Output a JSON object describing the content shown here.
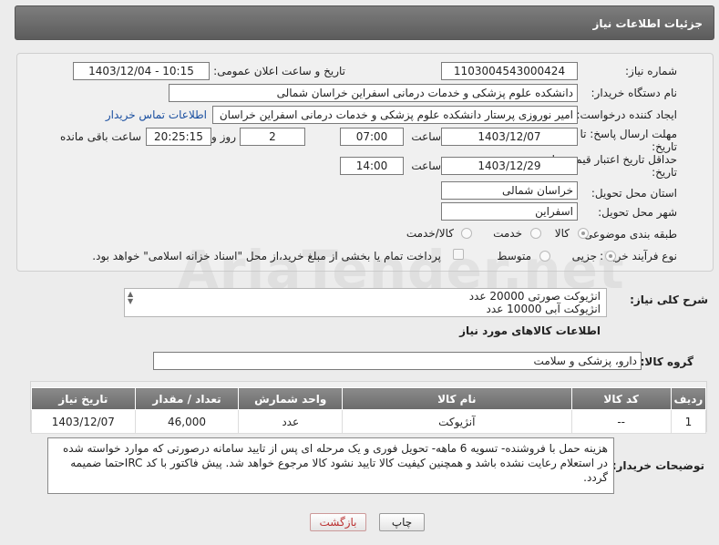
{
  "header": {
    "title": "جزئیات اطلاعات نیاز"
  },
  "watermark": "AriaTender.net",
  "form": {
    "need_number_label": "شماره نیاز:",
    "need_number": "1103004543000424",
    "announce_label": "تاریخ و ساعت اعلان عمومی:",
    "announce_value": "1403/12/04 - 10:15",
    "buyer_org_label": "نام دستگاه خریدار:",
    "buyer_org": "دانشکده علوم پزشکی و خدمات درمانی اسفراین خراسان شمالی",
    "creator_label": "ایجاد کننده درخواست:",
    "creator": "امیر  نوروزی  پرستار  دانشکده علوم پزشکی و خدمات درمانی اسفراین خراسان",
    "contact_link": "اطلاعات تماس خریدار",
    "deadline_label_1": "مهلت ارسال پاسخ: تا",
    "deadline_label_2": "تاریخ:",
    "deadline_date": "1403/12/07",
    "time_label": "ساعت",
    "deadline_time": "07:00",
    "days_value": "2",
    "days_label": "روز و",
    "remaining_time": "20:25:15",
    "remaining_label": "ساعت باقی مانده",
    "validity_label_1": "حداقل تاریخ اعتبار قیمت: تا",
    "validity_label_2": "تاریخ:",
    "validity_date": "1403/12/29",
    "validity_time": "14:00",
    "province_label": "استان محل تحویل:",
    "province": "خراسان شمالی",
    "city_label": "شهر محل تحویل:",
    "city": "اسفراین",
    "category_label": "طبقه بندی موضوعی:",
    "category_options": [
      "کالا",
      "خدمت",
      "کالا/خدمت"
    ],
    "purchase_type_label": "نوع فرآیند خرید :",
    "purchase_options": [
      "جزیی",
      "متوسط"
    ],
    "payment_note": "پرداخت تمام یا بخشی از مبلغ خرید،از محل \"اسناد خزانه اسلامی\" خواهد بود."
  },
  "summary": {
    "label": "شرح کلی نیاز:",
    "line1": "انژیوکت صورتی 20000 عدد",
    "line2": "انژیوکت آبی 10000 عدد"
  },
  "goods": {
    "section_title": "اطلاعات کالاهای مورد نیاز",
    "group_label": "گروه کالا:",
    "group_value": "دارو، پزشکی و سلامت",
    "columns": [
      "ردیف",
      "کد کالا",
      "نام کالا",
      "واحد شمارش",
      "تعداد / مقدار",
      "تاریخ نیاز"
    ],
    "rows": [
      {
        "row": "1",
        "code": "--",
        "name": "آنژیوکت",
        "unit": "عدد",
        "qty": "46,000",
        "date": "1403/12/07"
      }
    ]
  },
  "buyer_notes": {
    "label": "توضیحات خریدار:",
    "text": "هزینه حمل با فروشنده- تسویه 6 ماهه- تحویل فوری و یک مرحله ای پس از تایید سامانه درصورتی که موارد خواسته شده در استعلام رعایت نشده باشد و همچنین کیفیت کالا تایید نشود کالا مرجوع خواهد شد. پیش فاکتور با کد IRCحتما ضمیمه گردد."
  },
  "buttons": {
    "print": "چاپ",
    "back": "بازگشت"
  }
}
